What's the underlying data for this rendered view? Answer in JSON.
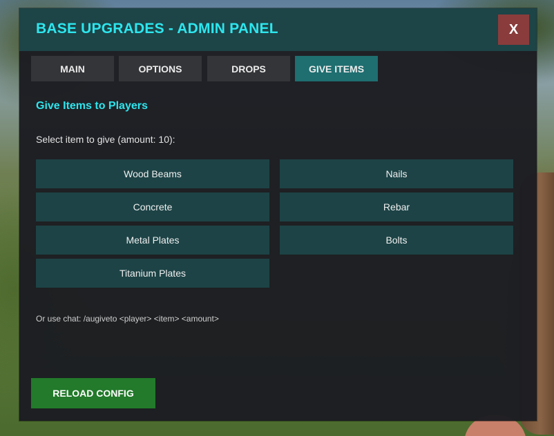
{
  "header": {
    "title": "BASE UPGRADES - ADMIN PANEL",
    "close_label": "X"
  },
  "tabs": [
    {
      "label": "MAIN",
      "active": false
    },
    {
      "label": "OPTIONS",
      "active": false
    },
    {
      "label": "DROPS",
      "active": false
    },
    {
      "label": "GIVE ITEMS",
      "active": true
    }
  ],
  "give_items": {
    "section_title": "Give Items to Players",
    "instruction": "Select item to give (amount: 10):",
    "items": [
      {
        "label": "Wood Beams"
      },
      {
        "label": "Nails"
      },
      {
        "label": "Concrete"
      },
      {
        "label": "Rebar"
      },
      {
        "label": "Metal Plates"
      },
      {
        "label": "Bolts"
      },
      {
        "label": "Titanium Plates"
      }
    ],
    "chat_hint": "Or use chat: /augiveto <player> <item> <amount>"
  },
  "footer": {
    "reload_label": "RELOAD CONFIG"
  },
  "colors": {
    "accent": "#2de6ee",
    "header_bg": "#1d4447",
    "active_tab": "#1f6e70",
    "close": "#8a3c3c",
    "reload": "#227a2a"
  }
}
